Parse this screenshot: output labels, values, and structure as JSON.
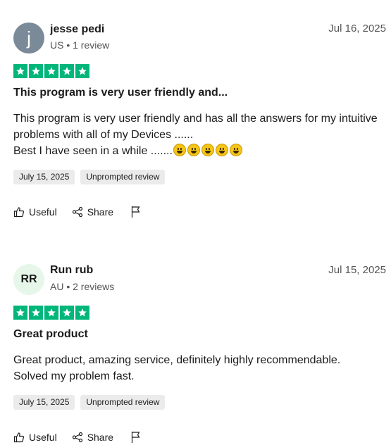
{
  "reviews": [
    {
      "avatar_letter": "j",
      "name": "jesse pedi",
      "meta": "US • 1 review",
      "date": "Jul 16, 2025",
      "rating": 5,
      "title": "This program is very user friendly and...",
      "body_line1": "This program is very user friendly and has all the answers for my intuitive problems with all of my Devices ......",
      "body_line2": "Best I have seen in a while .......",
      "emoji_count": 5,
      "experience_date": "July 15, 2025",
      "tag": "Unprompted review",
      "useful_label": "Useful",
      "share_label": "Share"
    },
    {
      "avatar_letter": "RR",
      "name": "Run rub",
      "meta": "AU • 2 reviews",
      "date": "Jul 15, 2025",
      "rating": 5,
      "title": "Great product",
      "body_line1": "Great product, amazing service, definitely highly recommendable.",
      "body_line2": "Solved my problem fast.",
      "experience_date": "July 15, 2025",
      "tag": "Unprompted review",
      "useful_label": "Useful",
      "share_label": "Share"
    }
  ],
  "colors": {
    "star_green": "#00b67a",
    "avatar_gray": "#7b8a98",
    "avatar_mint": "#e6f7ea",
    "chip_bg": "#ebebeb"
  },
  "icons": {
    "star": "star-icon",
    "useful": "thumbs-up-icon",
    "share": "share-icon",
    "report": "flag-icon",
    "emoji": "grinning-face-emoji"
  }
}
